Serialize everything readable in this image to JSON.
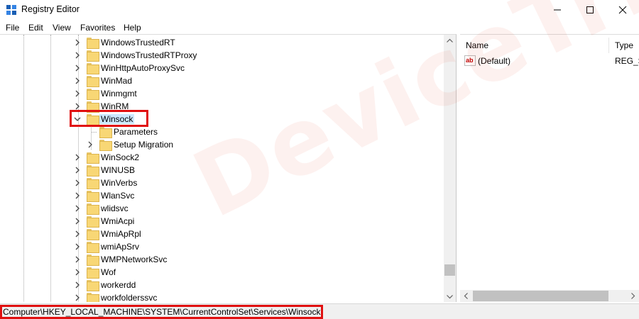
{
  "window": {
    "title": "Registry Editor",
    "accent": "#e01010"
  },
  "menu": [
    "File",
    "Edit",
    "View",
    "Favorites",
    "Help"
  ],
  "tree": {
    "items": [
      {
        "label": "WindowsTrustedRT",
        "level": 0,
        "expander": "right"
      },
      {
        "label": "WindowsTrustedRTProxy",
        "level": 0,
        "expander": "right"
      },
      {
        "label": "WinHttpAutoProxySvc",
        "level": 0,
        "expander": "right"
      },
      {
        "label": "WinMad",
        "level": 0,
        "expander": "right"
      },
      {
        "label": "Winmgmt",
        "level": 0,
        "expander": "right"
      },
      {
        "label": "WinRM",
        "level": 0,
        "expander": "right"
      },
      {
        "label": "Winsock",
        "level": 0,
        "expander": "down",
        "selected": true
      },
      {
        "label": "Parameters",
        "level": 1,
        "expander": "none"
      },
      {
        "label": "Setup Migration",
        "level": 1,
        "expander": "right"
      },
      {
        "label": "WinSock2",
        "level": 0,
        "expander": "right"
      },
      {
        "label": "WINUSB",
        "level": 0,
        "expander": "right"
      },
      {
        "label": "WinVerbs",
        "level": 0,
        "expander": "right"
      },
      {
        "label": "WlanSvc",
        "level": 0,
        "expander": "right"
      },
      {
        "label": "wlidsvc",
        "level": 0,
        "expander": "right"
      },
      {
        "label": "WmiAcpi",
        "level": 0,
        "expander": "right"
      },
      {
        "label": "WmiApRpl",
        "level": 0,
        "expander": "right"
      },
      {
        "label": "wmiApSrv",
        "level": 0,
        "expander": "right"
      },
      {
        "label": "WMPNetworkSvc",
        "level": 0,
        "expander": "right"
      },
      {
        "label": "Wof",
        "level": 0,
        "expander": "right"
      },
      {
        "label": "workerdd",
        "level": 0,
        "expander": "right"
      },
      {
        "label": "workfolderssvc",
        "level": 0,
        "expander": "right"
      }
    ]
  },
  "list": {
    "columns": [
      "Name",
      "Type"
    ],
    "rows": [
      {
        "name": "(Default)",
        "type": "REG_SZ",
        "icon": "string-value-icon"
      }
    ]
  },
  "status": {
    "path": "Computer\\HKEY_LOCAL_MACHINE\\SYSTEM\\CurrentControlSet\\Services\\Winsock"
  },
  "watermark": "DeviceTricks"
}
